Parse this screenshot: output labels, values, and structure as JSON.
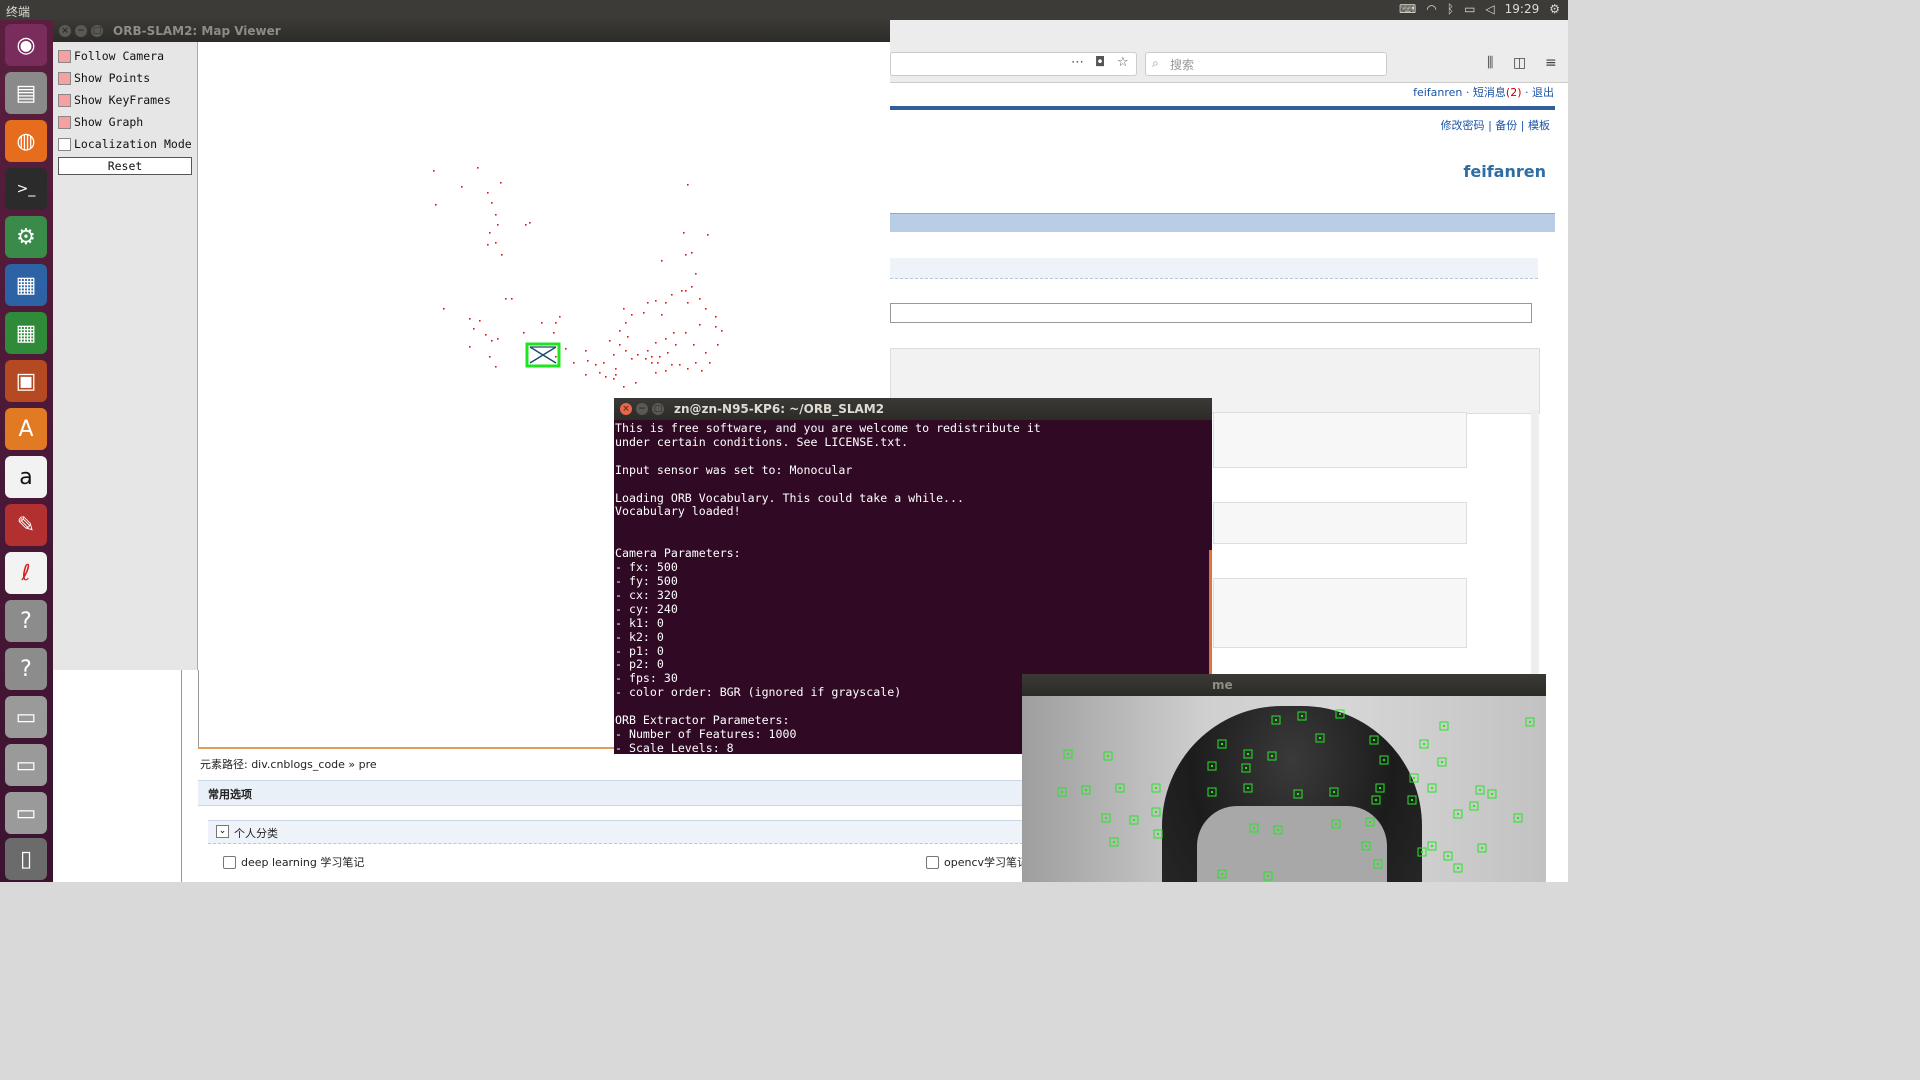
{
  "top_panel": {
    "app_name": "终端",
    "time": "19:29"
  },
  "launcher": {
    "items": [
      "ubuntu-icon",
      "files-icon",
      "firefox-icon",
      "terminal-icon",
      "settings-icon",
      "writer-icon",
      "calc-icon",
      "impress-icon",
      "software-center-icon",
      "amazon-icon",
      "tools-icon",
      "reader-icon",
      "help-icon",
      "help-icon",
      "drive-icon",
      "drive-icon",
      "drive-icon",
      "trash-icon"
    ]
  },
  "browser": {
    "search_placeholder": "搜索",
    "user_link": "feifanren",
    "messages_link": "短消息",
    "messages_count": "(2)",
    "logout_link": "退出",
    "sep": "·",
    "change_pwd": "修改密码",
    "backup": "备份",
    "template": "模板",
    "bar_sep": "|",
    "brand": "feifanren",
    "element_path": "元素路径: div.cnblogs_code » pre",
    "common_options": "常用选项",
    "personal_category": "个人分类",
    "check_1": "deep learning 学习笔记",
    "check_2": "opencv学习笔记"
  },
  "map_viewer": {
    "title": "ORB-SLAM2: Map Viewer",
    "options": [
      {
        "label": "Follow Camera",
        "checked": true
      },
      {
        "label": "Show Points",
        "checked": true
      },
      {
        "label": "Show KeyFrames",
        "checked": true
      },
      {
        "label": "Show Graph",
        "checked": true
      },
      {
        "label": "Localization Mode",
        "checked": false
      }
    ],
    "reset": "Reset",
    "point_color": "#e81010",
    "keyframe_color": "#1ee61e"
  },
  "terminal": {
    "title": "zn@zn-N95-KP6: ~/ORB_SLAM2",
    "lines": [
      "This is free software, and you are welcome to redistribute it",
      "under certain conditions. See LICENSE.txt.",
      "",
      "Input sensor was set to: Monocular",
      "",
      "Loading ORB Vocabulary. This could take a while...",
      "Vocabulary loaded!",
      "",
      "",
      "Camera Parameters:",
      "- fx: 500",
      "- fy: 500",
      "- cx: 320",
      "- cy: 240",
      "- k1: 0",
      "- k2: 0",
      "- p1: 0",
      "- p2: 0",
      "- fps: 30",
      "- color order: BGR (ignored if grayscale)",
      "",
      "ORB Extractor Parameters:",
      "- Number of Features: 1000",
      "- Scale Levels: 8"
    ]
  },
  "frame_viewer": {
    "title_fragment": "me",
    "feature_color": "#22e622"
  }
}
